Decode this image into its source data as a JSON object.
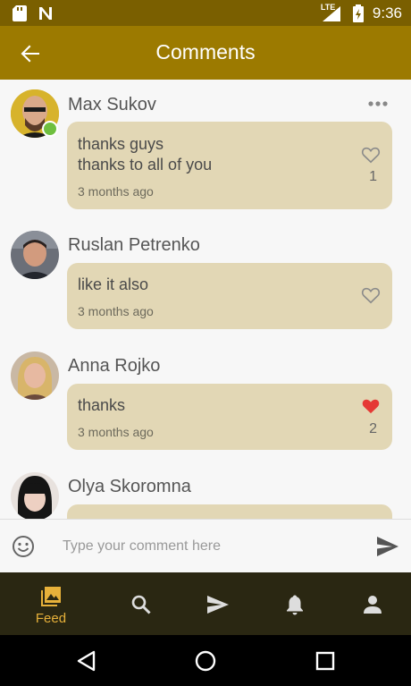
{
  "status_bar": {
    "network": "LTE",
    "time": "9:36"
  },
  "header": {
    "title": "Comments"
  },
  "comments": [
    {
      "author": "Max Sukov",
      "text": "thanks guys\nthanks to all of you",
      "time": "3 months ago",
      "likes": "1",
      "liked": false,
      "online": true
    },
    {
      "author": "Ruslan Petrenko",
      "text": "like it also",
      "time": "3 months ago",
      "likes": "",
      "liked": false,
      "online": false
    },
    {
      "author": "Anna Rojko",
      "text": "thanks",
      "time": "3 months ago",
      "likes": "2",
      "liked": true,
      "online": false
    },
    {
      "author": "Olya Skoromna",
      "text": "",
      "time": "",
      "likes": "",
      "liked": false,
      "online": false
    }
  ],
  "composer": {
    "placeholder": "Type your comment here",
    "value": ""
  },
  "bottom_nav": {
    "items": [
      {
        "icon": "photos-icon",
        "label": "Feed",
        "active": true
      },
      {
        "icon": "search-icon",
        "label": ""
      },
      {
        "icon": "send-icon",
        "label": ""
      },
      {
        "icon": "bell-icon",
        "label": ""
      },
      {
        "icon": "person-icon",
        "label": ""
      }
    ]
  },
  "colors": {
    "header": "#9c7a00",
    "status_bar": "#7a5f00",
    "bubble": "#e2d7b5",
    "nav_bg": "#2a2712",
    "accent": "#e7b13a",
    "liked_heart": "#e53935",
    "online": "#6fbf3f"
  }
}
